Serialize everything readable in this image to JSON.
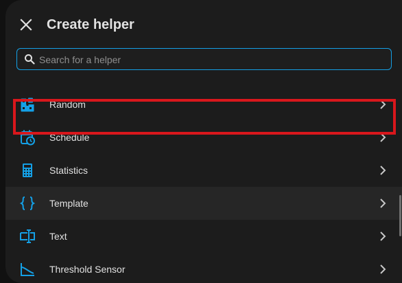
{
  "dialog": {
    "title": "Create helper",
    "close_icon": "close-icon"
  },
  "search": {
    "placeholder": "Search for a helper",
    "value": "",
    "accent": "#14a0e6"
  },
  "items": [
    {
      "label": "Random",
      "icon": "dice-icon",
      "selected": false
    },
    {
      "label": "Schedule",
      "icon": "calendar-clock-icon",
      "selected": false
    },
    {
      "label": "Statistics",
      "icon": "calculator-icon",
      "selected": false
    },
    {
      "label": "Template",
      "icon": "code-braces-icon",
      "selected": true
    },
    {
      "label": "Text",
      "icon": "text-field-icon",
      "selected": false
    },
    {
      "label": "Threshold Sensor",
      "icon": "threshold-chart-icon",
      "selected": false
    }
  ],
  "colors": {
    "icon": "#14a0e6",
    "highlight": "#d9171c",
    "background": "#1c1c1c",
    "text": "#e1e1e1"
  }
}
